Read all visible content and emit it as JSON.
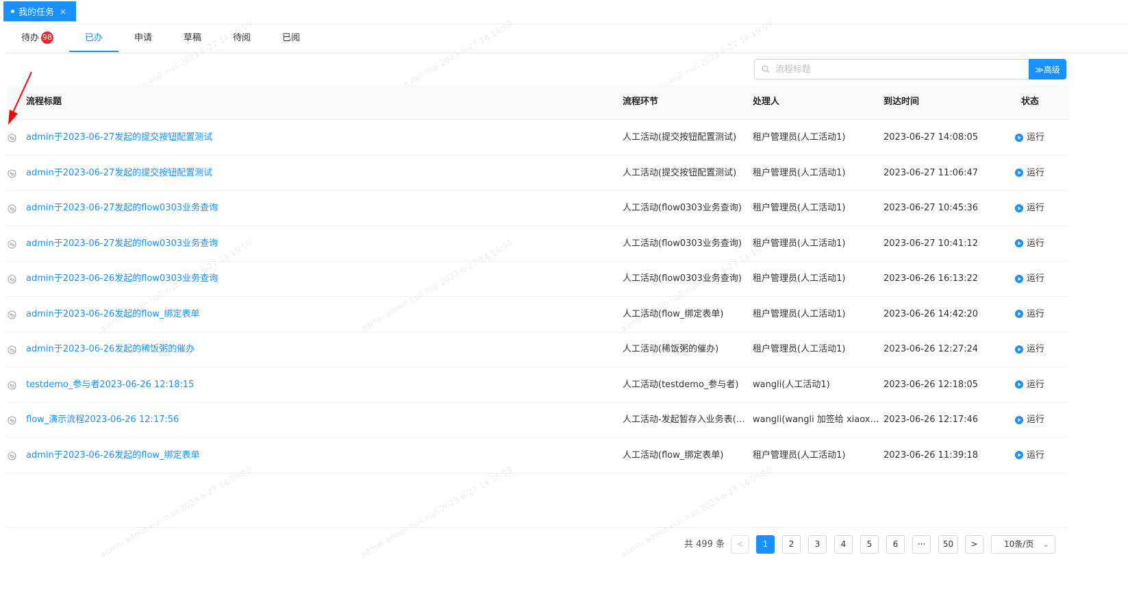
{
  "page_tab": {
    "label": "我的任务",
    "close": "×"
  },
  "tabs": [
    {
      "label": "待办",
      "badge": "98"
    },
    {
      "label": "已办"
    },
    {
      "label": "申请"
    },
    {
      "label": "草稿"
    },
    {
      "label": "待阅"
    },
    {
      "label": "已阅"
    }
  ],
  "search": {
    "placeholder": "流程标题",
    "advanced_label": "≫高级"
  },
  "table": {
    "headers": [
      "流程标题",
      "流程环节",
      "处理人",
      "到达时间",
      "状态"
    ],
    "rows": [
      {
        "title": "admin于2023-06-27发起的提交按钮配置测试",
        "step": "人工活动(提交按钮配置测试)",
        "handler": "租户管理员(人工活动1)",
        "time": "2023-06-27 14:08:05",
        "status": "运行"
      },
      {
        "title": "admin于2023-06-27发起的提交按钮配置测试",
        "step": "人工活动(提交按钮配置测试)",
        "handler": "租户管理员(人工活动1)",
        "time": "2023-06-27 11:06:47",
        "status": "运行"
      },
      {
        "title": "admin于2023-06-27发起的flow0303业务查询",
        "step": "人工活动(flow0303业务查询)",
        "handler": "租户管理员(人工活动1)",
        "time": "2023-06-27 10:45:36",
        "status": "运行"
      },
      {
        "title": "admin于2023-06-27发起的flow0303业务查询",
        "step": "人工活动(flow0303业务查询)",
        "handler": "租户管理员(人工活动1)",
        "time": "2023-06-27 10:41:12",
        "status": "运行"
      },
      {
        "title": "admin于2023-06-26发起的flow0303业务查询",
        "step": "人工活动(flow0303业务查询)",
        "handler": "租户管理员(人工活动1)",
        "time": "2023-06-26 16:13:22",
        "status": "运行"
      },
      {
        "title": "admin于2023-06-26发起的flow_绑定表单",
        "step": "人工活动(flow_绑定表单)",
        "handler": "租户管理员(人工活动1)",
        "time": "2023-06-26 14:42:20",
        "status": "运行"
      },
      {
        "title": "admin于2023-06-26发起的稀饭粥的催办",
        "step": "人工活动(稀饭粥的催办)",
        "handler": "租户管理员(人工活动1)",
        "time": "2023-06-26 12:27:24",
        "status": "运行"
      },
      {
        "title": "testdemo_参与者2023-06-26 12:18:15",
        "step": "人工活动(testdemo_参与者)",
        "handler": "wangli(人工活动1)",
        "time": "2023-06-26 12:18:05",
        "status": "运行"
      },
      {
        "title": "flow_演示流程2023-06-26 12:17:56",
        "step": "人工活动-发起暂存入业务表(fl…",
        "handler": "wangli(wangli 加签给 xiaoxiao)",
        "time": "2023-06-26 12:17:46",
        "status": "运行"
      },
      {
        "title": "admin于2023-06-26发起的flow_绑定表单",
        "step": "人工活动(flow_绑定表单)",
        "handler": "租户管理员(人工活动1)",
        "time": "2023-06-26 11:39:18",
        "status": "运行"
      }
    ]
  },
  "pagination": {
    "total_text": "共 499 条",
    "prev": "<",
    "next": ">",
    "pages": [
      "1",
      "2",
      "3",
      "4",
      "5",
      "6",
      "···",
      "50"
    ],
    "page_size": "10条/页"
  },
  "watermark": "admin admin null null 2023-6-27 14:16:59",
  "colors": {
    "primary": "#1890ff",
    "badge": "#f5222d",
    "arrow": "#ff0000"
  }
}
